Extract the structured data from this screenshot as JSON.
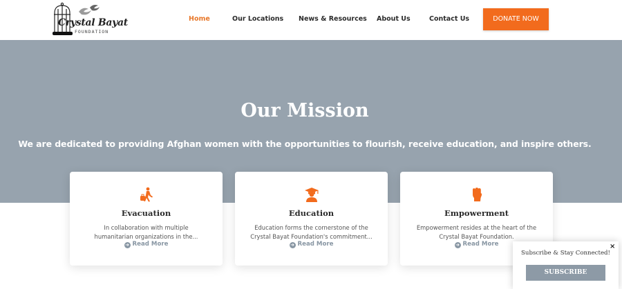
{
  "header": {
    "logo": {
      "name": "Crystal Bayat",
      "subtitle": "FOUNDATION",
      "icon": "birdcage-logo-icon"
    },
    "nav": [
      {
        "label": "Home",
        "active": true
      },
      {
        "label": "Our Locations",
        "active": false
      },
      {
        "label": "News & Resources",
        "active": false
      },
      {
        "label": "About Us",
        "active": false
      },
      {
        "label": "Contact Us",
        "active": false
      }
    ],
    "donate_label": "DONATE NOW"
  },
  "hero": {
    "title": "Our Mission",
    "subtitle": "We are dedicated to providing Afghan women with the opportunities to flourish, receive education, and inspire others."
  },
  "cards": [
    {
      "icon": "person-walking-luggage-icon",
      "title": "Evacuation",
      "text": "In collaboration with multiple humanitarian organizations in the...",
      "more": "Read More"
    },
    {
      "icon": "graduate-icon",
      "title": "Education",
      "text": "Education forms the cornerstone of the Crystal Bayat Foundation's commitment...",
      "more": "Read More"
    },
    {
      "icon": "raised-fist-icon",
      "title": "Empowerment",
      "text": "Empowerment resides at the heart of the Crystal Bayat Foundation.",
      "more": "Read More"
    }
  ],
  "popup": {
    "text": "Subscribe & Stay Connected!",
    "button": "SUBSCRIBE",
    "close": "×"
  },
  "colors": {
    "accent": "#f26b1d",
    "hero_bg": "#97a3ae",
    "link": "#8896a3"
  }
}
